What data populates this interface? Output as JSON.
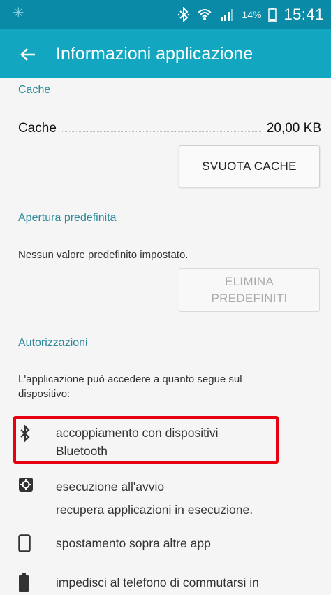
{
  "status_bar": {
    "battery_percent": "14%",
    "time": "15:41",
    "icons": [
      "notification-icon",
      "bluetooth-icon",
      "wifi-icon",
      "signal-icon",
      "battery-icon"
    ]
  },
  "app_bar": {
    "back_icon": "arrow-left-icon",
    "title": "Informazioni applicazione"
  },
  "cache_section": {
    "title": "Cache",
    "row_label": "Cache",
    "row_value": "20,00 KB",
    "button_label": "SVUOTA CACHE"
  },
  "default_open_section": {
    "title": "Apertura predefinita",
    "description": "Nessun valore predefinito impostato.",
    "button_line1": "ELIMINA",
    "button_line2": "PREDEFINITI",
    "button_enabled": false
  },
  "permissions_section": {
    "title": "Autorizzazioni",
    "description_line1": "L'applicazione può accedere a quanto segue sul",
    "description_line2": "dispositivo:",
    "items": [
      {
        "icon": "bluetooth-icon",
        "line1": "accoppiamento con dispositivi",
        "line2": "Bluetooth",
        "highlighted": true
      },
      {
        "icon": "gear-icon",
        "line1": "esecuzione all'avvio",
        "line2": "recupera applicazioni in esecuzione.",
        "highlighted": false
      },
      {
        "icon": "phone-icon",
        "line1": "spostamento sopra altre app",
        "line2": "",
        "highlighted": false
      },
      {
        "icon": "battery-icon",
        "line1": "impedisci al telefono di commutarsi in",
        "line2": "",
        "highlighted": false
      }
    ]
  },
  "colors": {
    "status_bar": "#0a8aa6",
    "app_bar": "#12a6c0",
    "section_title": "#2e8a9c",
    "highlight": "#e60012"
  }
}
